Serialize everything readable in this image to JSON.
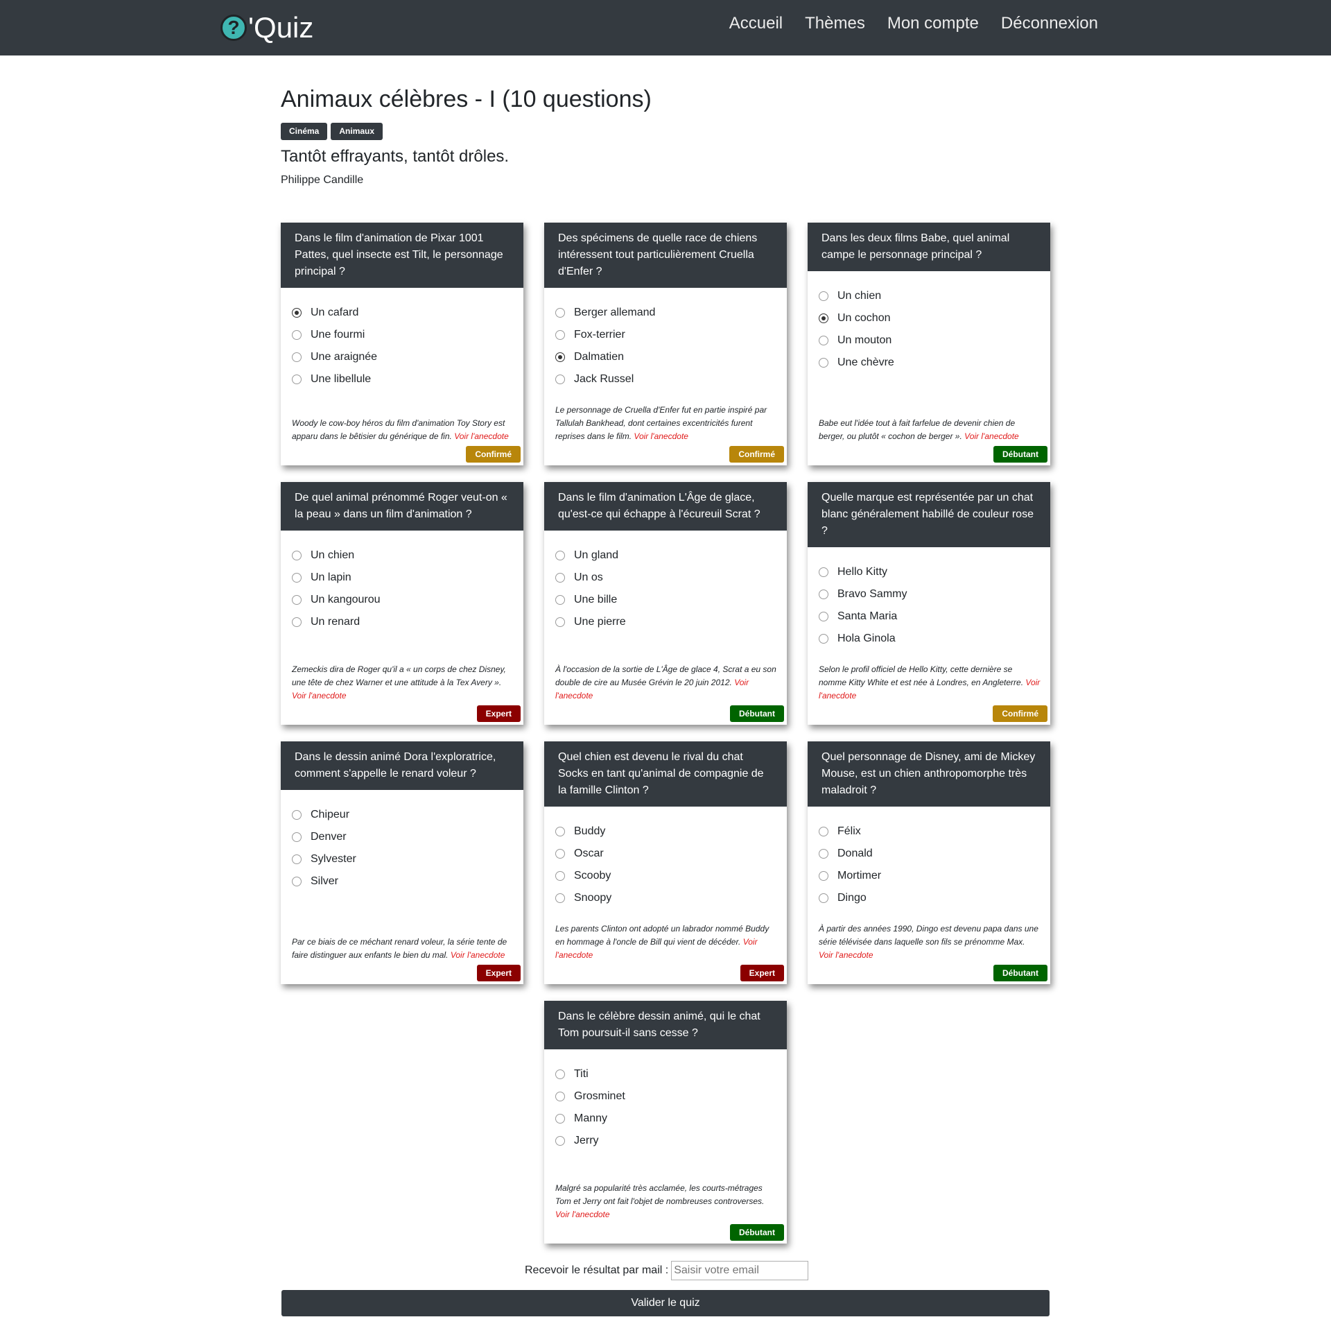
{
  "header": {
    "logo_text": "'Quiz",
    "logo_glyph": "?",
    "nav": [
      "Accueil",
      "Thèmes",
      "Mon compte",
      "Déconnexion"
    ]
  },
  "quiz": {
    "title": "Animaux célèbres - I (10 questions)",
    "tags": [
      "Cinéma",
      "Animaux"
    ],
    "subtitle": "Tantôt effrayants, tantôt drôles.",
    "author": "Philippe Candille"
  },
  "colors": {
    "Confirmé": "#b8860b",
    "Débutant": "#006400",
    "Expert": "#8b0000"
  },
  "anecdote_link": "Voir l'anecdote",
  "questions": [
    {
      "question": "Dans le film d'animation de Pixar 1001 Pattes, quel insecte est Tilt, le personnage principal ?",
      "answers": [
        "Un cafard",
        "Une fourmi",
        "Une araignée",
        "Une libellule"
      ],
      "selected": 0,
      "anecdote": "Woody le cow-boy héros du film d'animation Toy Story est apparu dans le bêtisier du générique de fin.",
      "level": "Confirmé"
    },
    {
      "question": "Des spécimens de quelle race de chiens intéressent tout particulièrement Cruella d'Enfer ?",
      "answers": [
        "Berger allemand",
        "Fox-terrier",
        "Dalmatien",
        "Jack Russel"
      ],
      "selected": 2,
      "anecdote": "Le personnage de Cruella d'Enfer fut en partie inspiré par Tallulah Bankhead, dont certaines excentricités furent reprises dans le film.",
      "level": "Confirmé"
    },
    {
      "question": "Dans les deux films Babe, quel animal campe le personnage principal ?",
      "answers": [
        "Un chien",
        "Un cochon",
        "Un mouton",
        "Une chèvre"
      ],
      "selected": 1,
      "anecdote": "Babe eut l'idée tout à fait farfelue de devenir chien de berger, ou plutôt « cochon de berger ».",
      "level": "Débutant"
    },
    {
      "question": "De quel animal prénommé Roger veut-on « la peau » dans un film d'animation ?",
      "answers": [
        "Un chien",
        "Un lapin",
        "Un kangourou",
        "Un renard"
      ],
      "selected": null,
      "anecdote": "Zemeckis dira de Roger qu'il a « un corps de chez Disney, une tête de chez Warner et une attitude à la Tex Avery ».",
      "level": "Expert"
    },
    {
      "question": "Dans le film d'animation L'Âge de glace, qu'est-ce qui échappe à l'écureuil Scrat ?",
      "answers": [
        "Un gland",
        "Un os",
        "Une bille",
        "Une pierre"
      ],
      "selected": null,
      "anecdote": "À l'occasion de la sortie de L'Âge de glace 4, Scrat a eu son double de cire au Musée Grévin le 20 juin 2012.",
      "level": "Débutant"
    },
    {
      "question": "Quelle marque est représentée par un chat blanc généralement habillé de couleur rose ?",
      "answers": [
        "Hello Kitty",
        "Bravo Sammy",
        "Santa Maria",
        "Hola Ginola"
      ],
      "selected": null,
      "anecdote": "Selon le profil officiel de Hello Kitty, cette dernière se nomme Kitty White et est née à Londres, en Angleterre.",
      "level": "Confirmé"
    },
    {
      "question": "Dans le dessin animé Dora l'exploratrice, comment s'appelle le renard voleur ?",
      "answers": [
        "Chipeur",
        "Denver",
        "Sylvester",
        "Silver"
      ],
      "selected": null,
      "anecdote": "Par ce biais de ce méchant renard voleur, la série tente de faire distinguer aux enfants le bien du mal.",
      "level": "Expert"
    },
    {
      "question": "Quel chien est devenu le rival du chat Socks en tant qu'animal de compagnie de la famille Clinton ?",
      "answers": [
        "Buddy",
        "Oscar",
        "Scooby",
        "Snoopy"
      ],
      "selected": null,
      "anecdote": "Les parents Clinton ont adopté un labrador nommé Buddy en hommage à l'oncle de Bill qui vient de décéder.",
      "level": "Expert"
    },
    {
      "question": "Quel personnage de Disney, ami de Mickey Mouse, est un chien anthropomorphe très maladroit ?",
      "answers": [
        "Félix",
        "Donald",
        "Mortimer",
        "Dingo"
      ],
      "selected": null,
      "anecdote": "À partir des années 1990, Dingo est devenu papa dans une série télévisée dans laquelle son fils se prénomme Max.",
      "level": "Débutant"
    },
    {
      "question": "Dans le célèbre dessin animé, qui le chat Tom poursuit-il sans cesse ?",
      "answers": [
        "Titi",
        "Grosminet",
        "Manny",
        "Jerry"
      ],
      "selected": null,
      "anecdote": "Malgré sa popularité très acclamée, les courts-métrages Tom et Jerry ont fait l'objet de nombreuses controverses.",
      "level": "Débutant"
    }
  ],
  "footer": {
    "email_label": "Recevoir le résultat par mail :",
    "email_placeholder": "Saisir votre email",
    "submit_label": "Valider le quiz"
  }
}
